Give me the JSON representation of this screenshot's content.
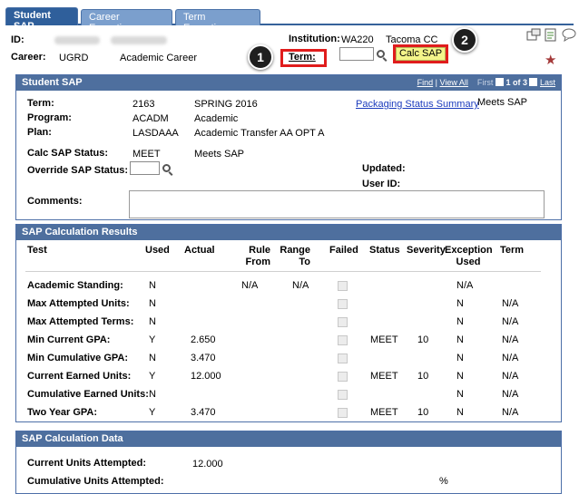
{
  "tabs": [
    "Student SAP",
    "Career Exceptions",
    "Term Exceptions"
  ],
  "header": {
    "id_label": "ID:",
    "career_label": "Career:",
    "career_value": "UGRD",
    "career_desc": "Academic Career",
    "institution_label": "Institution:",
    "institution_code": "WA220",
    "institution_name": "Tacoma CC",
    "term_label": "Term:",
    "term_value": "",
    "calc_button": "Calc SAP"
  },
  "callouts": {
    "one": "1",
    "two": "2"
  },
  "student_sap": {
    "title": "Student SAP",
    "find": "Find",
    "sep": "|",
    "view_all": "View All",
    "first": "First",
    "range": "1 of 3",
    "last": "Last",
    "term_label": "Term:",
    "term_code": "2163",
    "term_desc": "SPRING 2016",
    "program_label": "Program:",
    "program_code": "ACADM",
    "program_desc": "Academic",
    "plan_label": "Plan:",
    "plan_code": "LASDAAA",
    "plan_desc": "Academic Transfer AA OPT A",
    "packaging_link": "Packaging Status Summary",
    "packaging_value": "Meets SAP",
    "calc_status_label": "Calc SAP Status:",
    "calc_status_code": "MEET",
    "calc_status_desc": "Meets SAP",
    "override_label": "Override SAP Status:",
    "override_value": "",
    "updated_label": "Updated:",
    "userid_label": "User ID:",
    "comments_label": "Comments:",
    "comments_value": ""
  },
  "results": {
    "title": "SAP Calculation Results",
    "headers": {
      "test": "Test",
      "used": "Used",
      "actual": "Actual",
      "rule1": "Rule",
      "rule2": "From",
      "range1": "Range",
      "range2": "To",
      "failed": "Failed",
      "status": "Status",
      "severity": "Severity",
      "exc1": "Exception",
      "exc2": "Used",
      "term": "Term"
    },
    "rows": [
      {
        "test": "Academic Standing:",
        "used": "N",
        "actual": "",
        "rule": "N/A",
        "range": "N/A",
        "status": "",
        "severity": "",
        "exc": "N/A",
        "term": ""
      },
      {
        "test": "Max Attempted Units:",
        "used": "N",
        "actual": "",
        "rule": "",
        "range": "",
        "status": "",
        "severity": "",
        "exc": "N",
        "term": "N/A"
      },
      {
        "test": "Max Attempted Terms:",
        "used": "N",
        "actual": "",
        "rule": "",
        "range": "",
        "status": "",
        "severity": "",
        "exc": "N",
        "term": "N/A"
      },
      {
        "test": "Min Current GPA:",
        "used": "Y",
        "actual": "2.650",
        "rule": "",
        "range": "",
        "status": "MEET",
        "severity": "10",
        "exc": "N",
        "term": "N/A"
      },
      {
        "test": "Min Cumulative GPA:",
        "used": "N",
        "actual": "3.470",
        "rule": "",
        "range": "",
        "status": "",
        "severity": "",
        "exc": "N",
        "term": "N/A"
      },
      {
        "test": "Current Earned Units:",
        "used": "Y",
        "actual": "12.000",
        "rule": "",
        "range": "",
        "status": "MEET",
        "severity": "10",
        "exc": "N",
        "term": "N/A"
      },
      {
        "test": "Cumulative Earned Units:",
        "used": "N",
        "actual": "",
        "rule": "",
        "range": "",
        "status": "",
        "severity": "",
        "exc": "N",
        "term": "N/A"
      },
      {
        "test": "Two Year GPA:",
        "used": "Y",
        "actual": "3.470",
        "rule": "",
        "range": "",
        "status": "MEET",
        "severity": "10",
        "exc": "N",
        "term": "N/A"
      }
    ]
  },
  "calc_data": {
    "title": "SAP Calculation Data",
    "current_units_label": "Current Units Attempted:",
    "current_units_value": "12.000",
    "cum_units_label": "Cumulative Units Attempted:",
    "cum_units_pct": "%"
  },
  "icons": [
    "new-window-icon",
    "personalize-icon",
    "help-icon",
    "favorite-star-icon"
  ]
}
